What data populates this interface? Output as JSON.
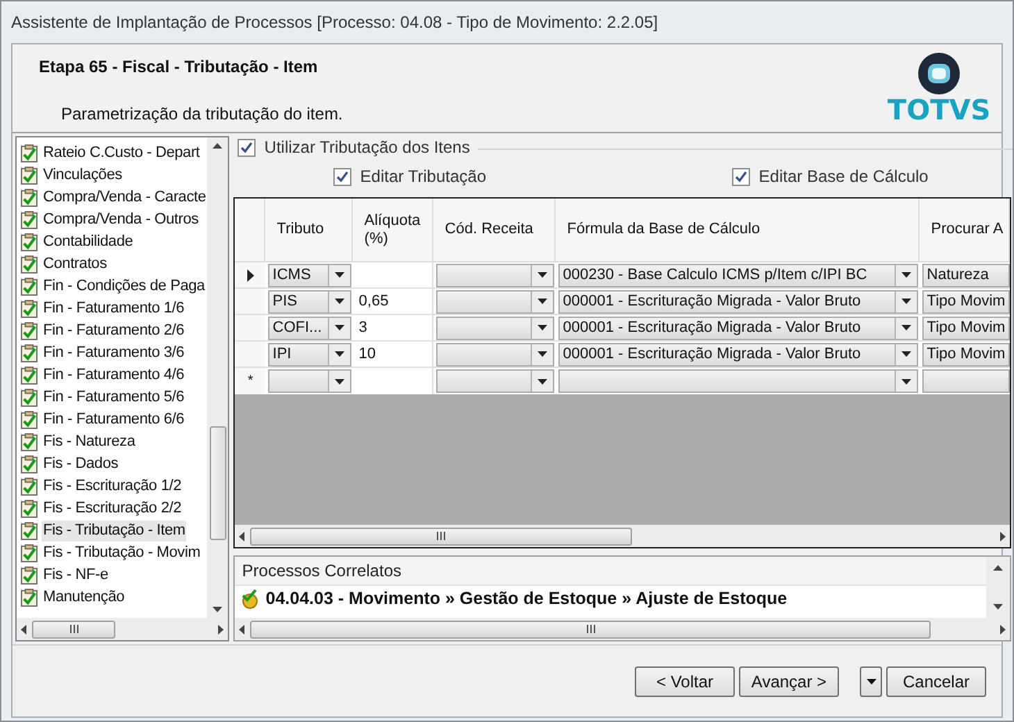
{
  "window": {
    "title": "Assistente de Implantação de Processos [Processo: 04.08 - Tipo de Movimento: 2.2.05]"
  },
  "header": {
    "step": "Etapa 65 - Fiscal - Tributação - Item",
    "description": "Parametrização da tributação do item.",
    "logo_text": "TOTVS"
  },
  "steps": [
    {
      "label": "Rateio C.Custo - Depart",
      "selected": false
    },
    {
      "label": "Vinculações",
      "selected": false
    },
    {
      "label": "Compra/Venda - Caracte",
      "selected": false
    },
    {
      "label": "Compra/Venda - Outros",
      "selected": false
    },
    {
      "label": "Contabilidade",
      "selected": false
    },
    {
      "label": "Contratos",
      "selected": false
    },
    {
      "label": "Fin - Condições de Paga",
      "selected": false
    },
    {
      "label": "Fin - Faturamento 1/6",
      "selected": false
    },
    {
      "label": "Fin - Faturamento 2/6",
      "selected": false
    },
    {
      "label": "Fin - Faturamento 3/6",
      "selected": false
    },
    {
      "label": "Fin - Faturamento 4/6",
      "selected": false
    },
    {
      "label": "Fin - Faturamento 5/6",
      "selected": false
    },
    {
      "label": "Fin - Faturamento 6/6",
      "selected": false
    },
    {
      "label": "Fis - Natureza",
      "selected": false
    },
    {
      "label": "Fis - Dados",
      "selected": false
    },
    {
      "label": "Fis - Escrituração 1/2",
      "selected": false
    },
    {
      "label": "Fis - Escrituração 2/2",
      "selected": false
    },
    {
      "label": "Fis - Tributação - Item",
      "selected": true
    },
    {
      "label": "Fis - Tributação - Movim",
      "selected": false
    },
    {
      "label": "Fis - NF-e",
      "selected": false
    },
    {
      "label": "Manutenção",
      "selected": false
    }
  ],
  "options": {
    "use_item_taxation": {
      "label": "Utilizar Tributação dos Itens",
      "checked": true
    },
    "edit_taxation": {
      "label": "Editar Tributação",
      "checked": true
    },
    "edit_base": {
      "label": "Editar Base de Cálculo",
      "checked": true
    }
  },
  "table": {
    "columns": [
      "Tributo",
      "Alíquota (%)",
      "Cód. Receita",
      "Fórmula da Base de Cálculo",
      "Procurar A"
    ],
    "rows": [
      {
        "selected": true,
        "tributo": "ICMS",
        "aliquota": "",
        "formula": "000230 - Base Calculo ICMS p/Item c/IPI BC",
        "procurar": "Natureza"
      },
      {
        "selected": false,
        "tributo": "PIS",
        "aliquota": "0,65",
        "formula": "000001 - Escrituração Migrada - Valor Bruto",
        "procurar": "Tipo Movim"
      },
      {
        "selected": false,
        "tributo": "COFI...",
        "aliquota": "3",
        "formula": "000001 - Escrituração Migrada - Valor Bruto",
        "procurar": "Tipo Movim"
      },
      {
        "selected": false,
        "tributo": "IPI",
        "aliquota": "10",
        "formula": "000001 - Escrituração Migrada - Valor Bruto",
        "procurar": "Tipo Movim"
      }
    ],
    "new_row_marker": "*"
  },
  "related": {
    "title": "Processos Correlatos",
    "items": [
      "04.04.03 - Movimento » Gestão de Estoque » Ajuste de Estoque"
    ]
  },
  "buttons": {
    "back": "< Voltar",
    "next": "Avançar >",
    "cancel": "Cancelar"
  }
}
